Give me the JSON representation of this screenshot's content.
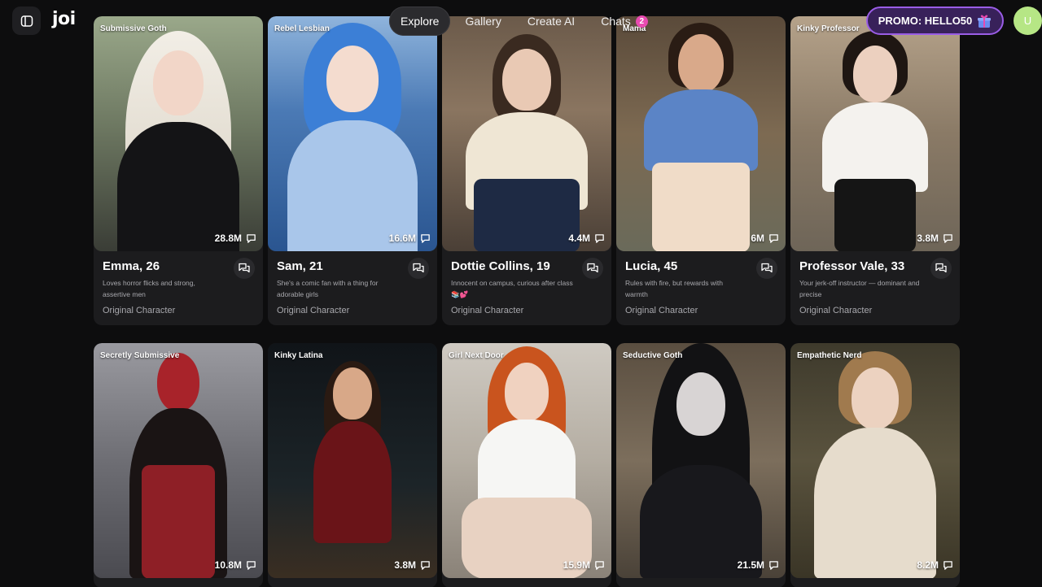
{
  "app": {
    "logo": "joi"
  },
  "nav": {
    "tabs": [
      {
        "label": "Explore",
        "active": true
      },
      {
        "label": "Gallery",
        "active": false
      },
      {
        "label": "Create AI",
        "active": false
      },
      {
        "label": "Chats",
        "active": false,
        "badge": "2"
      }
    ]
  },
  "promo": {
    "label": "PROMO: HELLO50",
    "icon": "gift-icon"
  },
  "user": {
    "initial": "U",
    "color": "#b6e685"
  },
  "colors": {
    "background": "#0d0d0e",
    "card": "#1c1c1e",
    "accent": "#e84ab0",
    "promo_border": "#9a5de6"
  },
  "cards": [
    {
      "tag": "Submissive Goth",
      "count": "28.8M",
      "name": "Emma, 26",
      "desc": "Loves horror flicks and strong, assertive men",
      "origin": "Original Character"
    },
    {
      "tag": "Rebel Lesbian",
      "count": "16.6M",
      "name": "Sam, 21",
      "desc": "She's a comic fan with a thing for adorable girls",
      "origin": "Original Character"
    },
    {
      "tag": "",
      "count": "4.4M",
      "name": "Dottie Collins, 19",
      "desc": "Innocent on campus, curious after class 📚💕",
      "origin": "Original Character"
    },
    {
      "tag": "Mama",
      "count": "6M",
      "name": "Lucia, 45",
      "desc": "Rules with fire, but rewards with warmth",
      "origin": "Original Character"
    },
    {
      "tag": "Kinky Professor",
      "count": "3.8M",
      "name": "Professor Vale, 33",
      "desc": "Your jerk-off instructor — dominant and precise",
      "origin": "Original Character"
    },
    {
      "tag": "Secretly Submissive",
      "count": "10.8M"
    },
    {
      "tag": "Kinky Latina",
      "count": "3.8M"
    },
    {
      "tag": "Girl Next Door",
      "count": "15.9M"
    },
    {
      "tag": "Seductive Goth",
      "count": "21.5M"
    },
    {
      "tag": "Empathetic Nerd",
      "count": "8.2M"
    }
  ]
}
